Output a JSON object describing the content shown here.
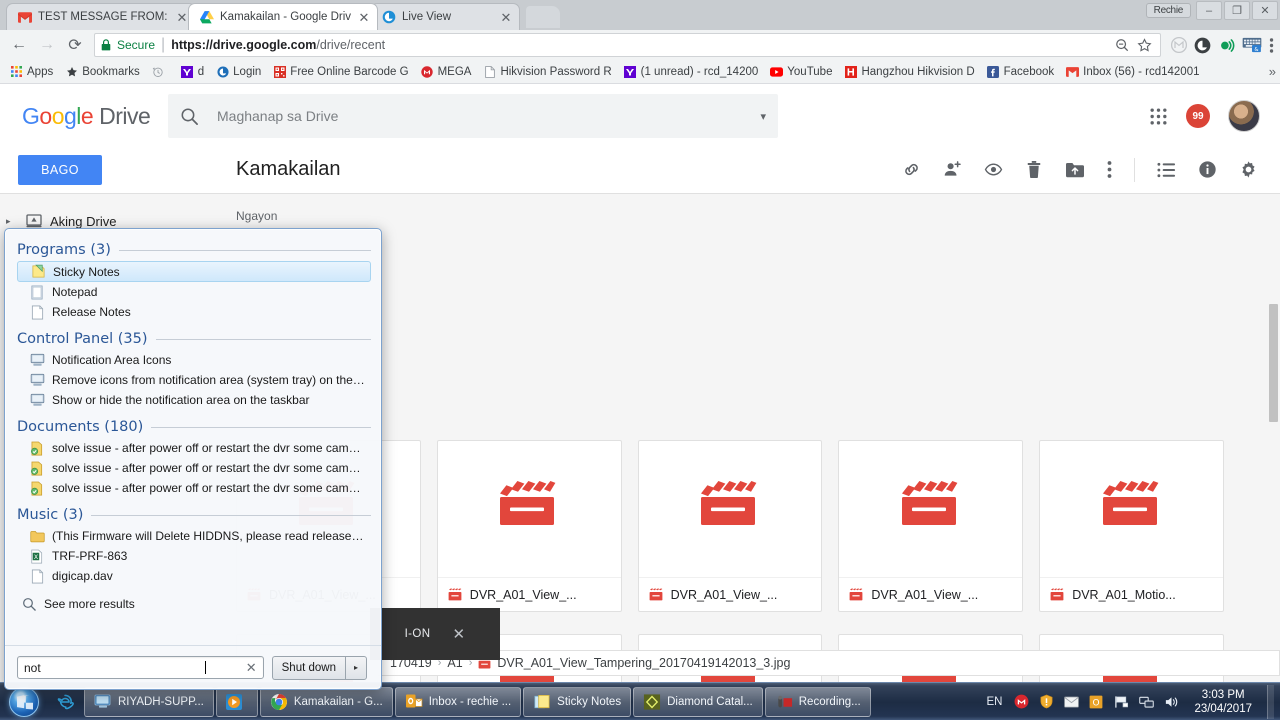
{
  "browser": {
    "profile_name": "Rechie",
    "window_controls": {
      "minimize": "–",
      "maximize": "❐",
      "close": "✕"
    },
    "tabs": [
      {
        "title": "TEST MESSAGE FROM: E",
        "favicon": "gmail-icon",
        "close": "✕",
        "active": false
      },
      {
        "title": "Kamakailan - Google Driv",
        "favicon": "google-drive-icon",
        "close": "✕",
        "active": true
      },
      {
        "title": "Live View",
        "favicon": "live-view-icon",
        "close": "✕",
        "active": false
      }
    ],
    "omnibox": {
      "back": "←",
      "forward": "→",
      "reload": "⟳",
      "secure_label": "Secure",
      "url_bold": "https://drive.google.com",
      "url_rest": "/drive/recent",
      "zoom_icon": "zoom-out-icon",
      "star_icon": "bookmark-star-icon",
      "menu_icon": "chrome-menu-icon"
    },
    "bookmarks": [
      {
        "label": "Apps",
        "icon": "apps-grid-icon"
      },
      {
        "label": "Bookmarks",
        "icon": "star-icon"
      },
      {
        "label": "",
        "icon": "history-icon"
      },
      {
        "label": "d",
        "icon": "yahoo-icon"
      },
      {
        "label": "Login",
        "icon": "edge-circle-icon"
      },
      {
        "label": "Free Online Barcode G",
        "icon": "barcode-icon"
      },
      {
        "label": "MEGA",
        "icon": "mega-icon"
      },
      {
        "label": "Hikvision Password R",
        "icon": "page-icon"
      },
      {
        "label": "(1 unread) - rcd_14200",
        "icon": "yahoo-icon"
      },
      {
        "label": "YouTube",
        "icon": "youtube-icon"
      },
      {
        "label": "Hangzhou Hikvision D",
        "icon": "hikvision-icon"
      },
      {
        "label": "Facebook",
        "icon": "facebook-icon"
      },
      {
        "label": "Inbox (56) - rcd142001",
        "icon": "gmail-icon"
      }
    ],
    "bookmarks_overflow": "»"
  },
  "drive": {
    "logo": {
      "g1": "G",
      "o1": "o",
      "o2": "o",
      "g2": "g",
      "l": "l",
      "e": "e",
      "product": "Drive"
    },
    "search": {
      "placeholder": "Maghanap sa Drive",
      "icon": "search-icon",
      "dropdown": "▾"
    },
    "header_right": {
      "apps_icon": "apps-grid-icon",
      "notification_count": "99",
      "avatar": "user-avatar"
    },
    "new_button": "BAGO",
    "page_title": "Kamakailan",
    "toolbar_icons": [
      "link-icon",
      "add-person-icon",
      "preview-eye-icon",
      "trash-icon",
      "move-to-folder-icon",
      "more-vertical-icon",
      "list-view-icon",
      "info-icon",
      "settings-gear-icon"
    ],
    "nav": {
      "caret": "▸",
      "icon": "my-drive-icon",
      "label": "Aking Drive"
    },
    "section_label": "Ngayon",
    "files": [
      {
        "name": "DVR_A01_View_...",
        "type_icon": "video-file-icon"
      },
      {
        "name": "DVR_A01_View_...",
        "type_icon": "video-file-icon"
      },
      {
        "name": "DVR_A01_View_...",
        "type_icon": "video-file-icon"
      },
      {
        "name": "DVR_A01_View_...",
        "type_icon": "video-file-icon"
      },
      {
        "name": "DVR_A01_Motio...",
        "type_icon": "video-file-icon"
      }
    ],
    "status_bar": {
      "crumb1": "170419",
      "sep": "›",
      "crumb2": "A1",
      "sep2": "›",
      "file_icon": "video-file-icon",
      "filename": "DVR_A01_View_Tampering_20170419142013_3.jpg"
    },
    "toast": {
      "label": "I-ON",
      "close": "✕"
    }
  },
  "start_menu": {
    "groups": [
      {
        "label": "Programs (3)",
        "items": [
          {
            "text": "Sticky Notes",
            "icon": "sticky-notes-icon",
            "selected": true
          },
          {
            "text": "Notepad",
            "icon": "notepad-icon",
            "selected": false
          },
          {
            "text": "Release Notes",
            "icon": "text-file-icon",
            "selected": false
          }
        ]
      },
      {
        "label": "Control Panel (35)",
        "items": [
          {
            "text": "Notification Area Icons",
            "icon": "control-panel-icon",
            "selected": false
          },
          {
            "text": "Remove icons from notification area (system tray) on the deskt...",
            "icon": "control-panel-icon",
            "selected": false
          },
          {
            "text": "Show or hide the notification area on the taskbar",
            "icon": "control-panel-icon",
            "selected": false
          }
        ]
      },
      {
        "label": "Documents (180)",
        "items": [
          {
            "text": "solve issue - after power off or restart the dvr some camera not ...",
            "icon": "word-doc-icon",
            "selected": false
          },
          {
            "text": "solve issue - after power off or restart the dvr some camera not ...",
            "icon": "word-doc-icon",
            "selected": false
          },
          {
            "text": "solve issue - after power off or restart the dvr some camera not ...",
            "icon": "word-doc-icon",
            "selected": false
          }
        ]
      },
      {
        "label": "Music (3)",
        "items": [
          {
            "text": "(This Firmware will Delete HIDDNS, please read released note b...",
            "icon": "folder-icon",
            "selected": false
          },
          {
            "text": "TRF-PRF-863",
            "icon": "excel-file-icon",
            "selected": false
          },
          {
            "text": "digicap.dav",
            "icon": "generic-file-icon",
            "selected": false
          }
        ]
      }
    ],
    "see_more": {
      "text": "See more results",
      "icon": "search-icon"
    },
    "search": {
      "value": "not",
      "clear": "✕",
      "icon": "text-cursor-icon"
    },
    "shutdown": {
      "label": "Shut down",
      "arrow": "▸"
    }
  },
  "taskbar": {
    "start_icon": "windows-start-orb",
    "quick_launch": [
      {
        "icon": "internet-explorer-icon"
      }
    ],
    "buttons": [
      {
        "label": "RIYADH-SUPP...",
        "icon": "remote-desktop-icon"
      },
      {
        "label": "",
        "icon": "media-player-icon"
      },
      {
        "label": "Kamakailan - G...",
        "icon": "chrome-icon"
      },
      {
        "label": "Inbox - rechie ...",
        "icon": "outlook-icon"
      },
      {
        "label": "Sticky Notes",
        "icon": "sticky-notes-icon"
      },
      {
        "label": "Diamond Catal...",
        "icon": "diamond-catalog-icon"
      },
      {
        "label": "Recording...",
        "icon": "recorder-icon"
      }
    ],
    "tray": {
      "language": "EN",
      "icons": [
        "mega-tray-icon",
        "security-alert-icon",
        "mail-tray-icon",
        "office-tray-icon",
        "flag-tray-icon",
        "network-tray-icon",
        "volume-tray-icon"
      ],
      "time": "3:03 PM",
      "date": "23/04/2017"
    }
  }
}
